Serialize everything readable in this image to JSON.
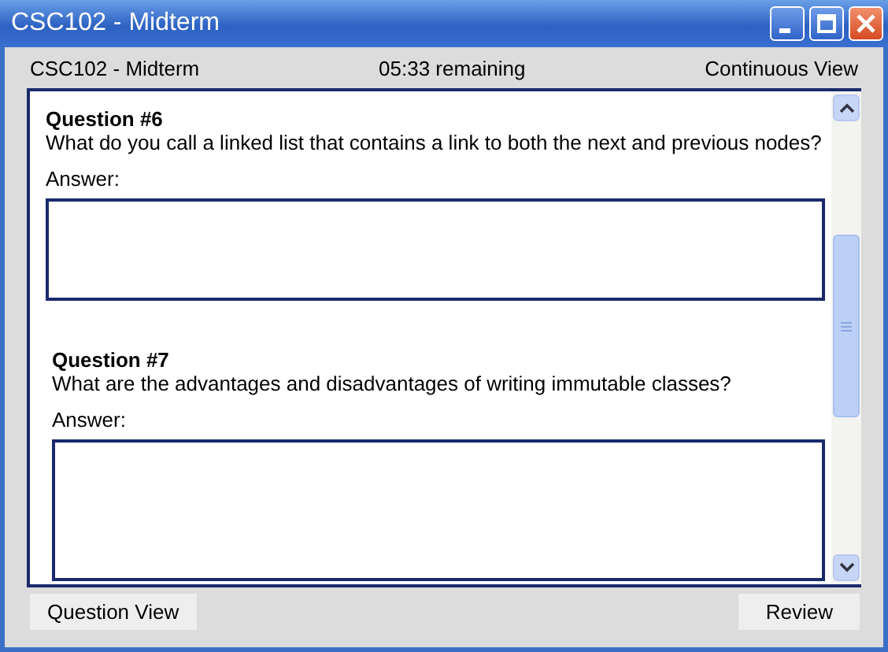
{
  "window": {
    "title": "CSC102 - Midterm"
  },
  "header": {
    "exam": "CSC102 - Midterm",
    "timer": "05:33 remaining",
    "view_mode": "Continuous View"
  },
  "questions": [
    {
      "title": "Question #6",
      "text": "What do you call a linked list that contains a link to both the next and previous nodes?",
      "answer_label": "Answer:"
    },
    {
      "title": "Question #7",
      "text": "What are the advantages and disadvantages of writing immutable classes?",
      "answer_label": "Answer:"
    }
  ],
  "buttons": {
    "left": "Question View",
    "right": "Review"
  }
}
